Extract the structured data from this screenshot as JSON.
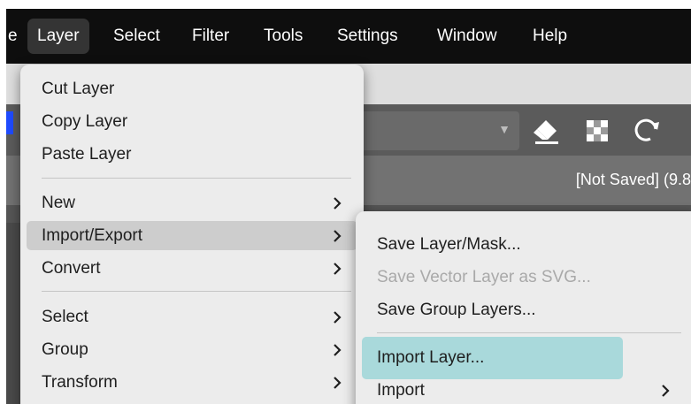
{
  "menubar": {
    "items": [
      {
        "label": "e"
      },
      {
        "label": "Layer"
      },
      {
        "label": "Select"
      },
      {
        "label": "Filter"
      },
      {
        "label": "Tools"
      },
      {
        "label": "Settings"
      },
      {
        "label": "Window"
      },
      {
        "label": "Help"
      }
    ]
  },
  "toolbar": {
    "icons": [
      "eraser-icon",
      "checkerboard-icon",
      "refresh-icon"
    ]
  },
  "document": {
    "status": "[Not Saved]  (9.8"
  },
  "layer_menu": {
    "groups": [
      [
        {
          "label": "Cut Layer"
        },
        {
          "label": "Copy Layer"
        },
        {
          "label": "Paste Layer"
        }
      ],
      [
        {
          "label": "New"
        },
        {
          "label": "Import/Export"
        },
        {
          "label": "Convert"
        }
      ],
      [
        {
          "label": "Select"
        },
        {
          "label": "Group"
        },
        {
          "label": "Transform"
        }
      ]
    ]
  },
  "import_export_menu": {
    "items": [
      {
        "label": "Save Layer/Mask..."
      },
      {
        "label": "Save Vector Layer as SVG..."
      },
      {
        "label": "Save Group Layers..."
      },
      {
        "label": "Import Layer..."
      },
      {
        "label": "Import"
      }
    ]
  },
  "colors": {
    "menubar_bg": "#0e0e0e",
    "menu_bg": "#ececec",
    "highlight": "#a9d9db",
    "hover": "#cdcdcd",
    "disabled_text": "#a9a9a9"
  }
}
